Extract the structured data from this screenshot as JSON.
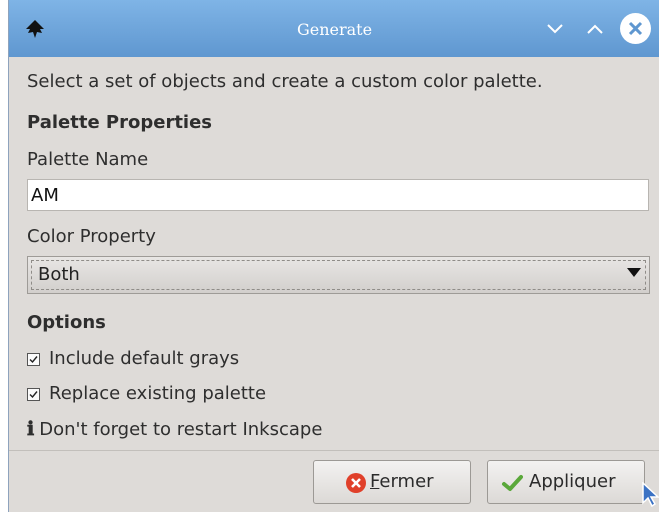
{
  "window": {
    "title": "Generate",
    "app_icon": "inkscape-icon",
    "controls": [
      "chevron-down-icon",
      "chevron-up-icon",
      "close-icon"
    ]
  },
  "instruction": "Select a set of objects and create a custom color palette.",
  "palette_properties": {
    "heading": "Palette Properties",
    "name_label": "Palette Name",
    "name_value": "AM",
    "color_property_label": "Color Property",
    "color_property_value": "Both"
  },
  "options": {
    "heading": "Options",
    "include_grays": {
      "label": "Include default grays",
      "checked": true
    },
    "replace_palette": {
      "label": "Replace existing palette",
      "checked": true
    }
  },
  "info": {
    "icon": "ℹ",
    "text": "Don't forget to restart Inkscape"
  },
  "buttons": {
    "close": {
      "label_mnemonic": "F",
      "label_rest": "ermer",
      "icon": "error-icon"
    },
    "apply": {
      "label": "Appliquer",
      "icon": "checkmark-icon"
    }
  },
  "colors": {
    "titlebar": "#6fa6de",
    "window_bg": "#dedbd8",
    "close_x": "#5f97d0",
    "error_red": "#e0402a",
    "check_green": "#5aa83a"
  }
}
